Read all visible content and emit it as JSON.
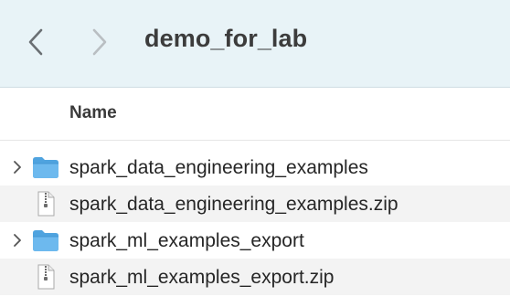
{
  "window": {
    "title": "demo_for_lab"
  },
  "navigation": {
    "back_icon": "chevron-left-icon",
    "forward_icon": "chevron-right-icon"
  },
  "columns": {
    "name_header": "Name"
  },
  "items": [
    {
      "name": "spark_data_engineering_examples",
      "kind": "folder",
      "icon": "folder-icon",
      "expandable": true
    },
    {
      "name": "spark_data_engineering_examples.zip",
      "kind": "zip",
      "icon": "zip-file-icon",
      "expandable": false
    },
    {
      "name": "spark_ml_examples_export",
      "kind": "folder",
      "icon": "folder-icon",
      "expandable": true
    },
    {
      "name": "spark_ml_examples_export.zip",
      "kind": "zip",
      "icon": "zip-file-icon",
      "expandable": false
    }
  ],
  "colors": {
    "titlebar_bg": "#e8f3f7",
    "folder_blue": "#5aaee6",
    "row_alt_bg": "#f3f3f3"
  }
}
